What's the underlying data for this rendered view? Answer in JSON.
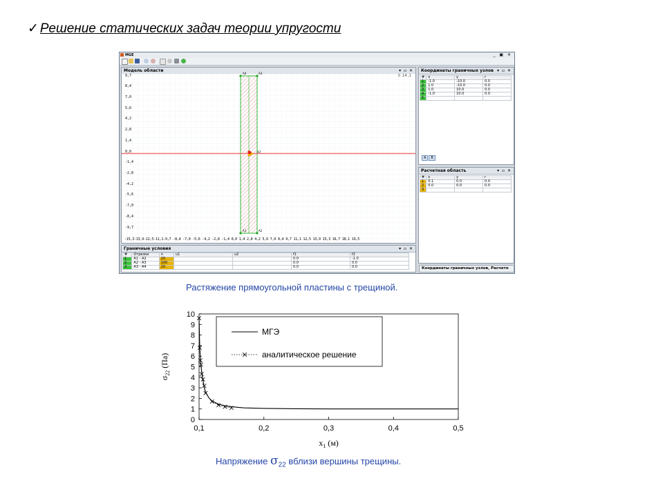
{
  "slide": {
    "check_mark": "✓",
    "title": "Решение статических задач теории упругости"
  },
  "app": {
    "title": "MGE",
    "window_controls": "_ ▣ ✕",
    "model_panel": {
      "title": "Модель области",
      "coord_readout": "0 ,14 ,1",
      "y_ticks": [
        "9,7",
        "8,4",
        "7,0",
        "5,6",
        "4,2",
        "2,8",
        "1,4",
        "0,0",
        "-1,4",
        "-2,8",
        "-4,2",
        "-5,6",
        "-7,0",
        "-8,4",
        "-9,7"
      ],
      "x_ticks_line": "-15,3-13,9-12,5-11,1-9,7 -8,4 -7,0 -5,6 -4,2 -2,8 -1,4 0,0  1,4  2,8  4,2  5,6  7,0  8,4  9,7  11,1 12,5 13,9 15,3 16,7 18,1 19,5",
      "node_labels": [
        "A4",
        "A3",
        "A1",
        "A2",
        "A7"
      ]
    },
    "boundary_coords_panel": {
      "title": "Координаты граничных узлов",
      "headers": [
        "#",
        "x",
        "y",
        "r"
      ],
      "rows": [
        [
          "1",
          "-1.0",
          "-10.0",
          "0.0"
        ],
        [
          "2",
          "1.0",
          "-10.0",
          "0.0"
        ],
        [
          "3",
          "1.0",
          "10.0",
          "0.0"
        ],
        [
          "4",
          "-1.0",
          "10.0",
          "0.0"
        ],
        [
          "5",
          "",
          "",
          ""
        ]
      ],
      "tabs": [
        "A",
        "B"
      ]
    },
    "calc_region_panel": {
      "title": "Расчетная область",
      "headers": [
        "#",
        "x",
        "y",
        "r"
      ],
      "rows": [
        [
          "1",
          "0.1",
          "0.0",
          "0.0"
        ],
        [
          "2",
          "0.0",
          "0.0",
          "0.0"
        ],
        [
          "3",
          "",
          "",
          ""
        ]
      ]
    },
    "boundary_cond_panel": {
      "title": "Граничные условия",
      "headers": [
        "#",
        "Отрезки",
        "n",
        "u1",
        "u2",
        "f1",
        "f2"
      ],
      "rows": [
        [
          "1",
          "A1 - A2",
          "20",
          "",
          "",
          "0.0",
          "-1.0"
        ],
        [
          "2",
          "A2 - A3",
          "100",
          "",
          "",
          "0.0",
          "0.0"
        ],
        [
          "3",
          "A3 - A4",
          "20",
          "",
          "",
          "0.0",
          "0.0"
        ]
      ]
    },
    "status_tabs": "Координаты граничных узлов, Расчетн"
  },
  "captions": {
    "top": "Растяжение  прямоугольной  пластины  с  трещиной.",
    "bottom_pre": "Напряжение  ",
    "bottom_sigma": "σ",
    "bottom_sub": "22",
    "bottom_post": " вблизи  вершины  трещины."
  },
  "chart_data": {
    "type": "line",
    "xlabel": "x1 (м)",
    "ylabel": "σ22 (Па)",
    "xlim": [
      0.1,
      0.5
    ],
    "ylim": [
      0,
      10
    ],
    "x_ticks": [
      "0,1",
      "0,2",
      "0,3",
      "0,4",
      "0,5"
    ],
    "y_ticks": [
      "0",
      "1",
      "2",
      "3",
      "4",
      "5",
      "6",
      "7",
      "8",
      "9",
      "10"
    ],
    "legend": [
      "МГЭ",
      "аналитическое решение"
    ],
    "series": [
      {
        "name": "МГЭ",
        "style": "solid",
        "x": [
          0.1,
          0.101,
          0.102,
          0.104,
          0.106,
          0.108,
          0.11,
          0.115,
          0.12,
          0.13,
          0.14,
          0.15,
          0.17,
          0.2,
          0.25,
          0.3,
          0.35,
          0.4,
          0.45,
          0.5
        ],
        "y": [
          9.6,
          7.0,
          5.6,
          4.6,
          3.7,
          3.0,
          2.6,
          2.05,
          1.75,
          1.45,
          1.3,
          1.2,
          1.1,
          1.05,
          1.02,
          1.0,
          1.0,
          1.0,
          1.0,
          1.0
        ]
      },
      {
        "name": "аналитическое решение",
        "style": "dotted-x",
        "x": [
          0.1,
          0.101,
          0.102,
          0.103,
          0.104,
          0.106,
          0.108,
          0.11,
          0.12,
          0.13,
          0.14,
          0.15
        ],
        "y": [
          9.6,
          6.8,
          5.6,
          5.2,
          4.3,
          3.8,
          3.2,
          2.5,
          1.7,
          1.35,
          1.2,
          1.1
        ]
      }
    ]
  }
}
